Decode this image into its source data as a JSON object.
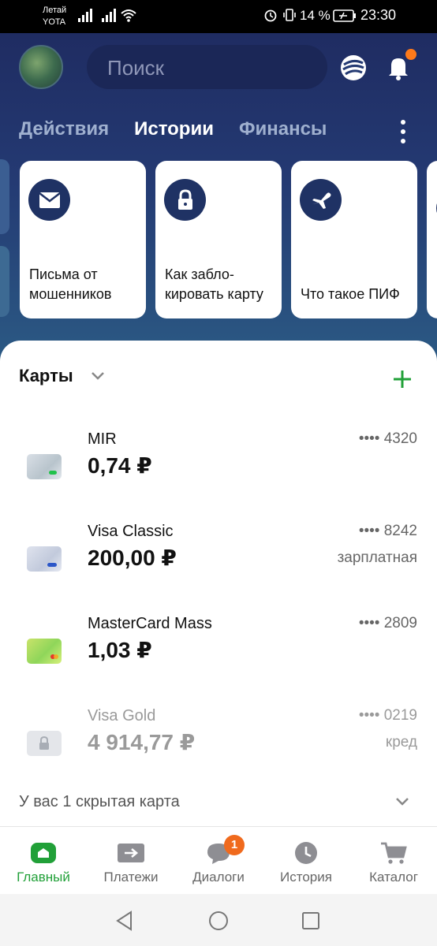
{
  "status_bar": {
    "carrier_line1": "Летай",
    "carrier_line2": "YOTA",
    "battery": "14 %",
    "time": "23:30"
  },
  "header": {
    "search_placeholder": "Поиск",
    "icons": [
      "avatar",
      "sber-logo-icon",
      "bell-icon"
    ],
    "notification_dot_color": "#ff7a1a"
  },
  "tabs": [
    {
      "label": "Действия",
      "active": false
    },
    {
      "label": "Истории",
      "active": true
    },
    {
      "label": "Финансы",
      "active": false
    }
  ],
  "stories": [
    {
      "icon": "mail-icon",
      "text": "Письма от\nмошенников"
    },
    {
      "icon": "lock-icon",
      "text": "Как забло-\nкировать карту"
    },
    {
      "icon": "plane-icon",
      "text": "Что такое ПИФ"
    }
  ],
  "cards_section": {
    "title": "Карты",
    "cards": [
      {
        "name": "MIR",
        "amount": "0,74 ₽",
        "number": "•••• 4320",
        "tag": ""
      },
      {
        "name": "Visa Classic",
        "amount": "200,00 ₽",
        "number": "•••• 8242",
        "tag": "зарплатная"
      },
      {
        "name": "MasterCard Mass",
        "amount": "1,03 ₽",
        "number": "•••• 2809",
        "tag": ""
      },
      {
        "name": "Visa Gold",
        "amount": "4 914,77 ₽",
        "number": "•••• 0219",
        "tag": "кред"
      }
    ],
    "hidden_note": "У вас 1 скрытая карта"
  },
  "bottom_nav": [
    {
      "label": "Главный",
      "icon": "home-icon",
      "active": true
    },
    {
      "label": "Платежи",
      "icon": "transfer-icon",
      "active": false
    },
    {
      "label": "Диалоги",
      "icon": "chat-icon",
      "active": false,
      "badge": "1"
    },
    {
      "label": "История",
      "icon": "clock-icon",
      "active": false
    },
    {
      "label": "Каталог",
      "icon": "cart-icon",
      "active": false
    }
  ],
  "colors": {
    "brand_green": "#21a038",
    "header_dark": "#1f2c62",
    "badge_orange": "#f06a1d"
  }
}
